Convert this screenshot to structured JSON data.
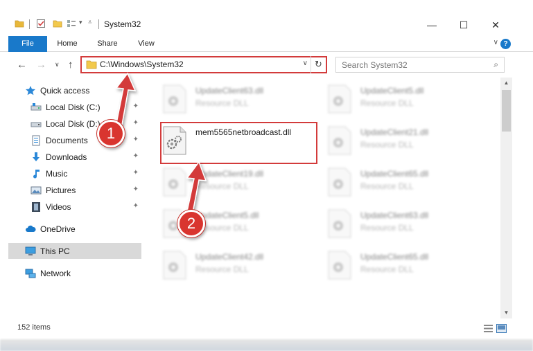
{
  "window": {
    "title": "System32",
    "minimize_glyph": "—",
    "maximize_glyph": "☐",
    "close_glyph": "✕"
  },
  "ribbon": {
    "tabs": [
      "File",
      "Home",
      "Share",
      "View"
    ],
    "help_glyph": "?",
    "collapse_glyph": "∨"
  },
  "nav": {
    "back_glyph": "←",
    "forward_glyph": "→",
    "recent_glyph": "∨",
    "up_glyph": "↑",
    "address_path": "C:\\Windows\\System32",
    "address_dropdown_glyph": "∨",
    "refresh_glyph": "↻",
    "search_placeholder": "Search System32",
    "search_glyph": "⌕"
  },
  "sidebar": {
    "items": [
      {
        "label": "Quick access",
        "icon": "star-icon",
        "pinned": false
      },
      {
        "label": "Local Disk (C:)",
        "icon": "drive-icon",
        "pinned": true
      },
      {
        "label": "Local Disk (D:)",
        "icon": "drive-icon",
        "pinned": true
      },
      {
        "label": "Documents",
        "icon": "documents-icon",
        "pinned": true
      },
      {
        "label": "Downloads",
        "icon": "download-arrow-icon",
        "pinned": true
      },
      {
        "label": "Music",
        "icon": "music-note-icon",
        "pinned": true
      },
      {
        "label": "Pictures",
        "icon": "pictures-icon",
        "pinned": true
      },
      {
        "label": "Videos",
        "icon": "film-icon",
        "pinned": true
      },
      {
        "label": "OneDrive",
        "icon": "cloud-icon",
        "pinned": false
      },
      {
        "label": "This PC",
        "icon": "monitor-icon",
        "pinned": false,
        "selected": true
      },
      {
        "label": "Network",
        "icon": "network-icon",
        "pinned": false
      }
    ],
    "pin_glyph": "📌"
  },
  "files": [
    {
      "name": "UpdateClient63.dll",
      "type": "Resource DLL",
      "blurred": true
    },
    {
      "name": "UpdateClient5.dll",
      "type": "Resource DLL",
      "blurred": true
    },
    {
      "name": "mem5565netbroadcast.dll",
      "type": "",
      "blurred": false,
      "highlighted": true
    },
    {
      "name": "UpdateClient21.dll",
      "type": "Resource DLL",
      "blurred": true
    },
    {
      "name": "UpdateClient19.dll",
      "type": "Resource DLL",
      "blurred": true
    },
    {
      "name": "UpdateClient65.dll",
      "type": "Resource DLL",
      "blurred": true
    },
    {
      "name": "UpdateClient5.dll",
      "type": "Resource DLL",
      "blurred": true
    },
    {
      "name": "UpdateClient63.dll",
      "type": "Resource DLL",
      "blurred": true
    },
    {
      "name": "UpdateClient42.dll",
      "type": "Resource DLL",
      "blurred": true
    },
    {
      "name": "UpdateClient65.dll",
      "type": "Resource DLL",
      "blurred": true
    }
  ],
  "status": {
    "item_count": "152 items"
  },
  "annotations": {
    "step1": "1",
    "step2": "2",
    "color": "#d33b3b"
  },
  "colors": {
    "accent": "#1979ca",
    "highlight_border": "#d33b3b",
    "selected_bg": "#d9d9d9"
  }
}
